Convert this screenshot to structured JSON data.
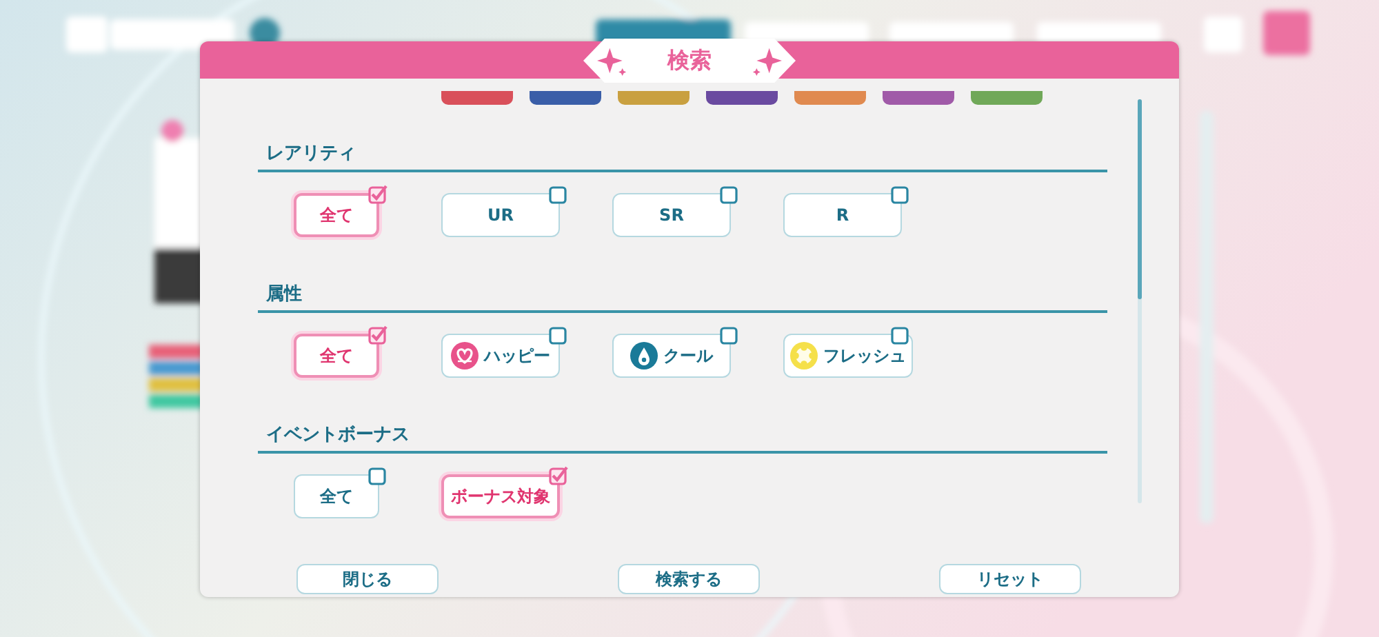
{
  "dialog": {
    "title": "検索"
  },
  "color_chips": [
    {
      "color": "#d9505a"
    },
    {
      "color": "#3a5ea8"
    },
    {
      "color": "#c9a040"
    },
    {
      "color": "#6a4aa0"
    },
    {
      "color": "#e08a50"
    },
    {
      "color": "#a05aa8"
    },
    {
      "color": "#70a858"
    }
  ],
  "sections": [
    {
      "title": "レアリティ",
      "options": [
        {
          "label": "全て",
          "kind": "all",
          "checked": true
        },
        {
          "label": "UR",
          "kind": "plain",
          "checked": false
        },
        {
          "label": "SR",
          "kind": "plain",
          "checked": false
        },
        {
          "label": "R",
          "kind": "plain",
          "checked": false
        }
      ]
    },
    {
      "title": "属性",
      "options": [
        {
          "label": "全て",
          "kind": "all",
          "checked": true
        },
        {
          "label": "ハッピー",
          "kind": "happy",
          "checked": false
        },
        {
          "label": "クール",
          "kind": "cool",
          "checked": false
        },
        {
          "label": "フレッシュ",
          "kind": "fresh",
          "checked": false
        }
      ]
    },
    {
      "title": "イベントボーナス",
      "options": [
        {
          "label": "全て",
          "kind": "all",
          "checked": false
        },
        {
          "label": "ボーナス対象",
          "kind": "plain",
          "checked": true
        }
      ]
    }
  ],
  "buttons": [
    "閉じる",
    "検索する",
    "リセット"
  ]
}
